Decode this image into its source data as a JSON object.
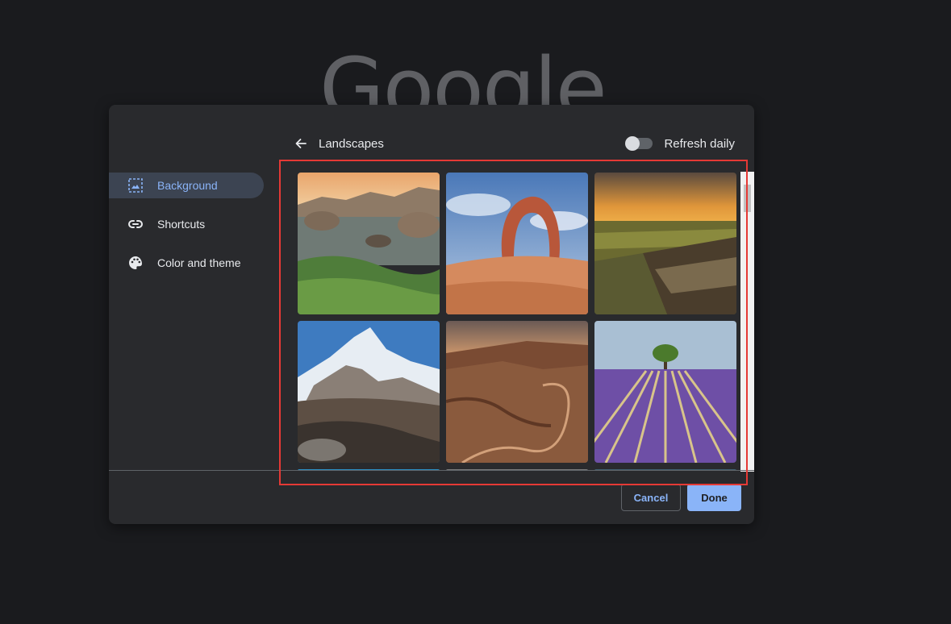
{
  "background_logo": "Google",
  "sidebar": {
    "items": [
      {
        "label": "Background",
        "icon": "image-icon",
        "active": true
      },
      {
        "label": "Shortcuts",
        "icon": "link-icon",
        "active": false
      },
      {
        "label": "Color and theme",
        "icon": "palette-icon",
        "active": false
      }
    ]
  },
  "header": {
    "title": "Landscapes",
    "refresh_label": "Refresh daily",
    "refresh_on": false
  },
  "images": [
    {
      "name": "rocky-coast"
    },
    {
      "name": "delicate-arch"
    },
    {
      "name": "canyon-sunset"
    },
    {
      "name": "snowy-mountain"
    },
    {
      "name": "desert-canyon-road"
    },
    {
      "name": "lavender-field-tree"
    }
  ],
  "footer": {
    "cancel_label": "Cancel",
    "done_label": "Done"
  },
  "colors": {
    "accent": "#8ab4f8",
    "dialog_bg": "#292a2d",
    "highlight": "#e53935"
  }
}
